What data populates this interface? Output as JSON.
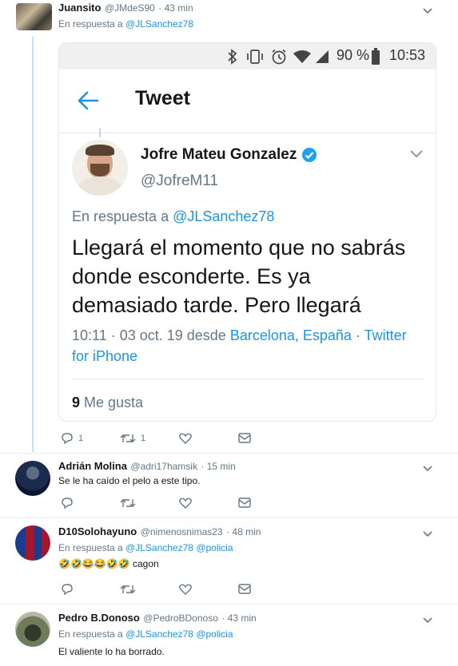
{
  "tweets": [
    {
      "name": "Juansito",
      "handle": "@JMdeS90",
      "time": "· 43 min",
      "reply_prefix": "En respuesta a",
      "reply_to": "@JLSanchez78",
      "actions": {
        "replies": "1",
        "retweets": "1"
      }
    },
    {
      "name": "Adrián Molina",
      "handle": "@adri17hamsik",
      "time": "· 15 min",
      "text": "Se le ha caído el pelo a este tipo."
    },
    {
      "name": "D10Solohayuno",
      "handle": "@nimenosnimas23",
      "time": "· 48 min",
      "reply_prefix": "En respuesta a",
      "reply_to": "@JLSanchez78",
      "reply_to_2": "@policia",
      "emojis": "🤣🤣😂😂🤣🤣",
      "text": "cagon"
    },
    {
      "name": "Pedro B.Donoso",
      "handle": "@PedroBDonoso",
      "time": "· 43 min",
      "reply_prefix": "En respuesta a",
      "reply_to": "@JLSanchez78",
      "reply_to_2": "@policia",
      "text": "El valiente lo ha borrado."
    }
  ],
  "screenshot": {
    "status": {
      "battery": "90 %",
      "time": "10:53"
    },
    "header_title": "Tweet",
    "author_name": "Jofre Mateu Gonzalez",
    "author_handle": "@JofreM11",
    "reply_prefix": "En respuesta a",
    "reply_to": "@JLSanchez78",
    "text": "Llegará el momento que no sabrás donde esconderte. Es ya demasiado tarde. Pero llegará",
    "meta_time": "10:11 · 03 oct. 19 desde",
    "meta_place": "Barcelona, España",
    "meta_dot": "·",
    "meta_client": "Twitter for iPhone",
    "likes_count": "9",
    "likes_label": "Me gusta"
  },
  "colors": {
    "accent": "#1b95e0",
    "muted": "#657786",
    "verified": "#1da1f2"
  }
}
